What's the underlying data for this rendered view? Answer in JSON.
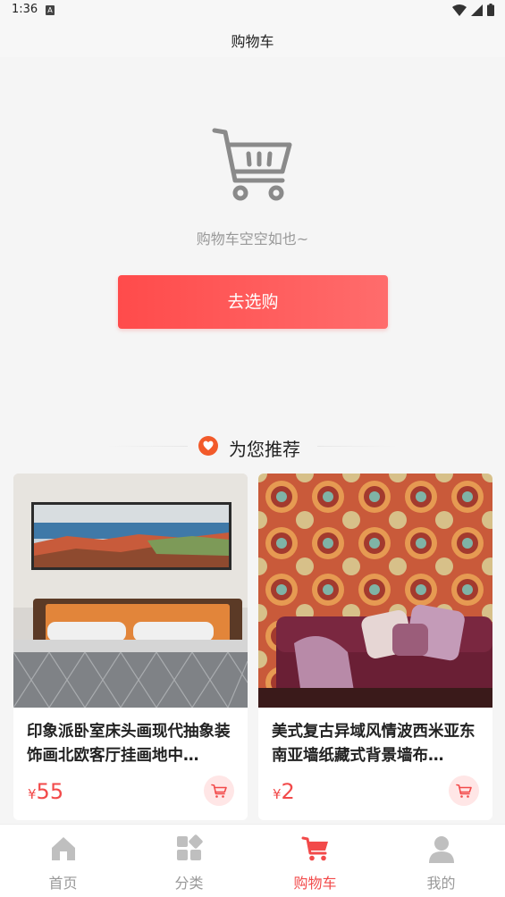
{
  "status_bar": {
    "time": "1:36",
    "a_label": "A"
  },
  "header": {
    "title": "购物车"
  },
  "empty_state": {
    "message": "购物车空空如也~",
    "button_label": "去选购"
  },
  "recommend": {
    "title": "为您推荐"
  },
  "products": [
    {
      "title": "印象派卧室床头画现代抽象装饰画北欧客厅挂画地中…",
      "currency": "¥",
      "price": "55"
    },
    {
      "title": "美式复古异域风情波西米亚东南亚墙纸藏式背景墙布…",
      "currency": "¥",
      "price": "2"
    }
  ],
  "tabs": [
    {
      "label": "首页",
      "icon": "home-icon"
    },
    {
      "label": "分类",
      "icon": "category-icon"
    },
    {
      "label": "购物车",
      "icon": "cart-icon",
      "active": true
    },
    {
      "label": "我的",
      "icon": "user-icon"
    }
  ],
  "colors": {
    "accent": "#f24a4a",
    "button_start": "#ff4b4b",
    "button_end": "#ff6c6c",
    "heart": "#f25a2a"
  }
}
